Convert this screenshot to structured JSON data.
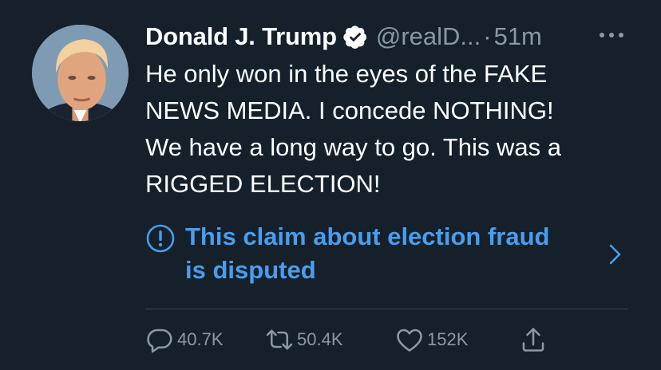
{
  "tweet": {
    "author_name": "Donald J. Trump",
    "handle": "@realD...",
    "separator": "·",
    "timestamp": "51m",
    "verified": true,
    "text_lines": [
      "He only won in the eyes of the FAKE",
      "NEWS MEDIA. I concede NOTHING!",
      "We have a long way to go. This was a",
      "RIGGED ELECTION!"
    ]
  },
  "notice": {
    "lines": [
      "This claim about election fraud",
      "is disputed"
    ],
    "icon": "exclamation-circle-icon",
    "color": "#4a9dec"
  },
  "actions": {
    "reply": {
      "icon": "reply-icon",
      "count": "40.7K"
    },
    "retweet": {
      "icon": "retweet-icon",
      "count": "50.4K"
    },
    "like": {
      "icon": "heart-icon",
      "count": "152K"
    },
    "share": {
      "icon": "share-icon"
    }
  },
  "colors": {
    "background": "#15202b",
    "text": "#ffffff",
    "secondary": "#8899a6",
    "accent": "#4a9dec",
    "divider": "#38444d"
  }
}
